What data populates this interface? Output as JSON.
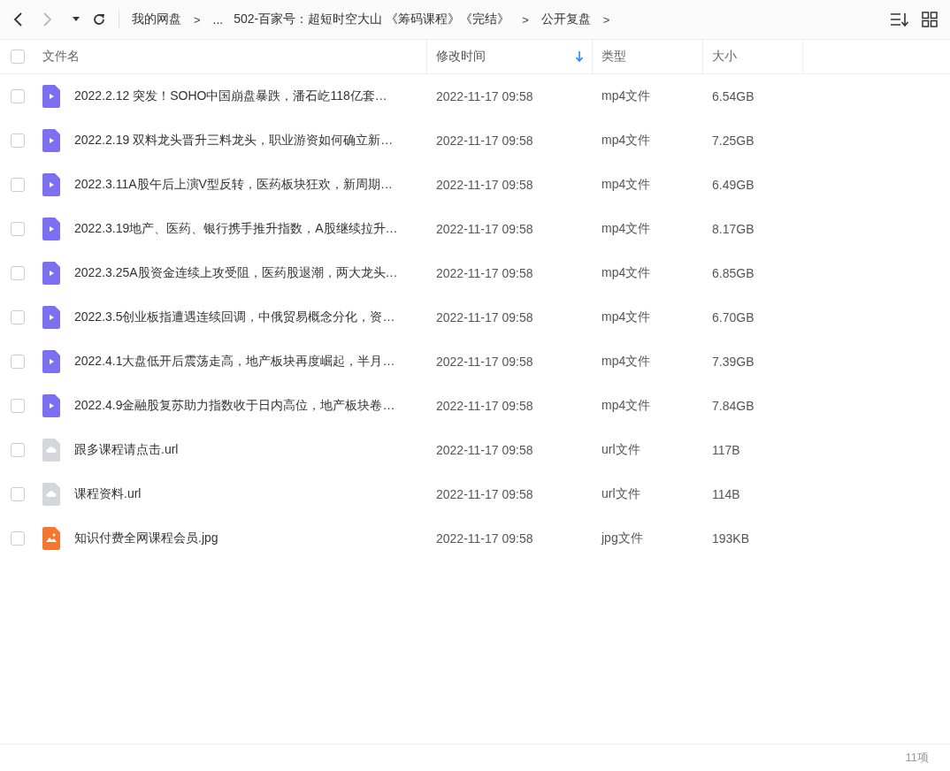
{
  "breadcrumb": [
    {
      "kind": "crumb",
      "label": "我的网盘"
    },
    {
      "kind": "sep",
      "label": ">"
    },
    {
      "kind": "crumb",
      "label": "..."
    },
    {
      "kind": "crumb",
      "label": "502-百家号：超短时空大山 《筹码课程》《完结》"
    },
    {
      "kind": "sep",
      "label": ">"
    },
    {
      "kind": "crumb",
      "label": "公开复盘"
    },
    {
      "kind": "sep",
      "label": ">"
    }
  ],
  "table": {
    "select_all": {
      "checked": false
    },
    "columns": [
      {
        "label": "文件名",
        "sorted": false
      },
      {
        "label": "修改时间",
        "sorted": true
      },
      {
        "label": "类型",
        "sorted": false
      },
      {
        "label": "大小",
        "sorted": false
      }
    ],
    "rows": [
      {
        "kind": "video",
        "checked": false,
        "name": "2022.2.12 突发！SOHO中国崩盘暴跌，潘石屹118亿套…",
        "modified": "2022-11-17 09:58",
        "type": "mp4文件",
        "size": "6.54GB"
      },
      {
        "kind": "video",
        "checked": false,
        "name": "2022.2.19 双料龙头晋升三料龙头，职业游资如何确立新…",
        "modified": "2022-11-17 09:58",
        "type": "mp4文件",
        "size": "7.25GB"
      },
      {
        "kind": "video",
        "checked": false,
        "name": "2022.3.11A股午后上演V型反转，医药板块狂欢，新周期…",
        "modified": "2022-11-17 09:58",
        "type": "mp4文件",
        "size": "6.49GB"
      },
      {
        "kind": "video",
        "checked": false,
        "name": "2022.3.19地产、医药、银行携手推升指数，A股继续拉升…",
        "modified": "2022-11-17 09:58",
        "type": "mp4文件",
        "size": "8.17GB"
      },
      {
        "kind": "video",
        "checked": false,
        "name": "2022.3.25A股资金连续上攻受阻，医药股退潮，两大龙头…",
        "modified": "2022-11-17 09:58",
        "type": "mp4文件",
        "size": "6.85GB"
      },
      {
        "kind": "video",
        "checked": false,
        "name": "2022.3.5创业板指遭遇连续回调，中俄贸易概念分化，资…",
        "modified": "2022-11-17 09:58",
        "type": "mp4文件",
        "size": "6.70GB"
      },
      {
        "kind": "video",
        "checked": false,
        "name": "2022.4.1大盘低开后震荡走高，地产板块再度崛起，半月…",
        "modified": "2022-11-17 09:58",
        "type": "mp4文件",
        "size": "7.39GB"
      },
      {
        "kind": "video",
        "checked": false,
        "name": "2022.4.9金融股复苏助力指数收于日内高位，地产板块卷…",
        "modified": "2022-11-17 09:58",
        "type": "mp4文件",
        "size": "7.84GB"
      },
      {
        "kind": "link",
        "checked": false,
        "name": "跟多课程请点击.url",
        "modified": "2022-11-17 09:58",
        "type": "url文件",
        "size": "117B"
      },
      {
        "kind": "link",
        "checked": false,
        "name": "课程资料.url",
        "modified": "2022-11-17 09:58",
        "type": "url文件",
        "size": "114B"
      },
      {
        "kind": "image",
        "checked": false,
        "name": "知识付费全网课程会员.jpg",
        "modified": "2022-11-17 09:58",
        "type": "jpg文件",
        "size": "193KB"
      }
    ]
  },
  "status_bar": {
    "count": "11项"
  }
}
